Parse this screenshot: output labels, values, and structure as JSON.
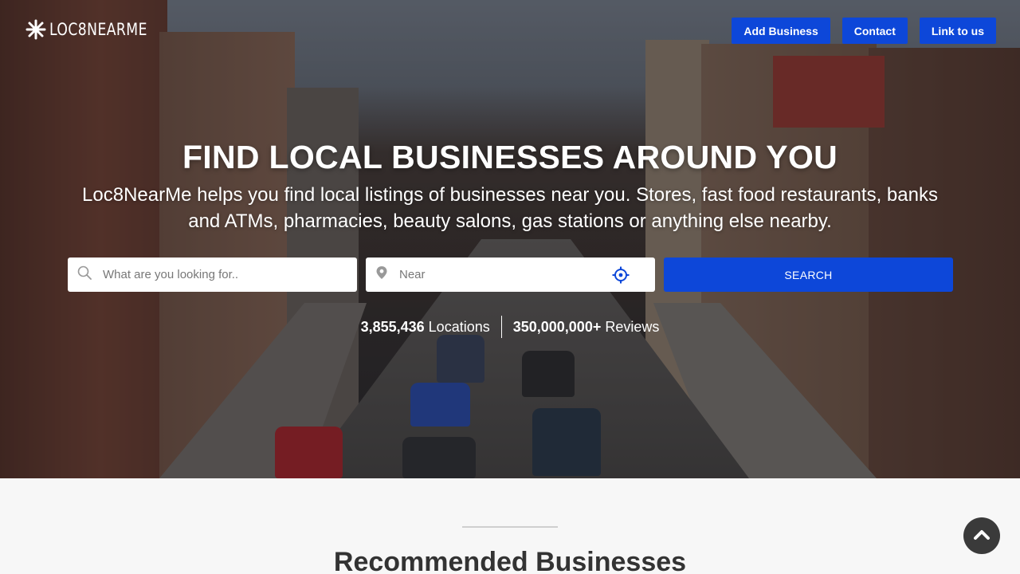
{
  "logo": {
    "text": "LOC8NEARME"
  },
  "nav": {
    "add_business": "Add Business",
    "contact": "Contact",
    "link_to_us": "Link to us"
  },
  "hero": {
    "title": "FIND LOCAL BUSINESSES AROUND YOU",
    "subtitle": "Loc8NearMe helps you find local listings of businesses near you. Stores, fast food restaurants, banks and ATMs, pharmacies, beauty salons, gas stations or anything else nearby."
  },
  "search": {
    "what_placeholder": "What are you looking for..",
    "near_placeholder": "Near",
    "button_label": "SEARCH"
  },
  "stats": {
    "locations_count": "3,855,436",
    "locations_label": "Locations",
    "reviews_count": "350,000,000+",
    "reviews_label": "Reviews"
  },
  "section": {
    "title": "Recommended Businesses"
  },
  "colors": {
    "accent": "#0d47d9",
    "scroll_top_bg": "#3a3a3a"
  },
  "icons": [
    "logo-star-icon",
    "search-icon",
    "map-pin-icon",
    "crosshair-icon",
    "chevron-up-icon"
  ]
}
